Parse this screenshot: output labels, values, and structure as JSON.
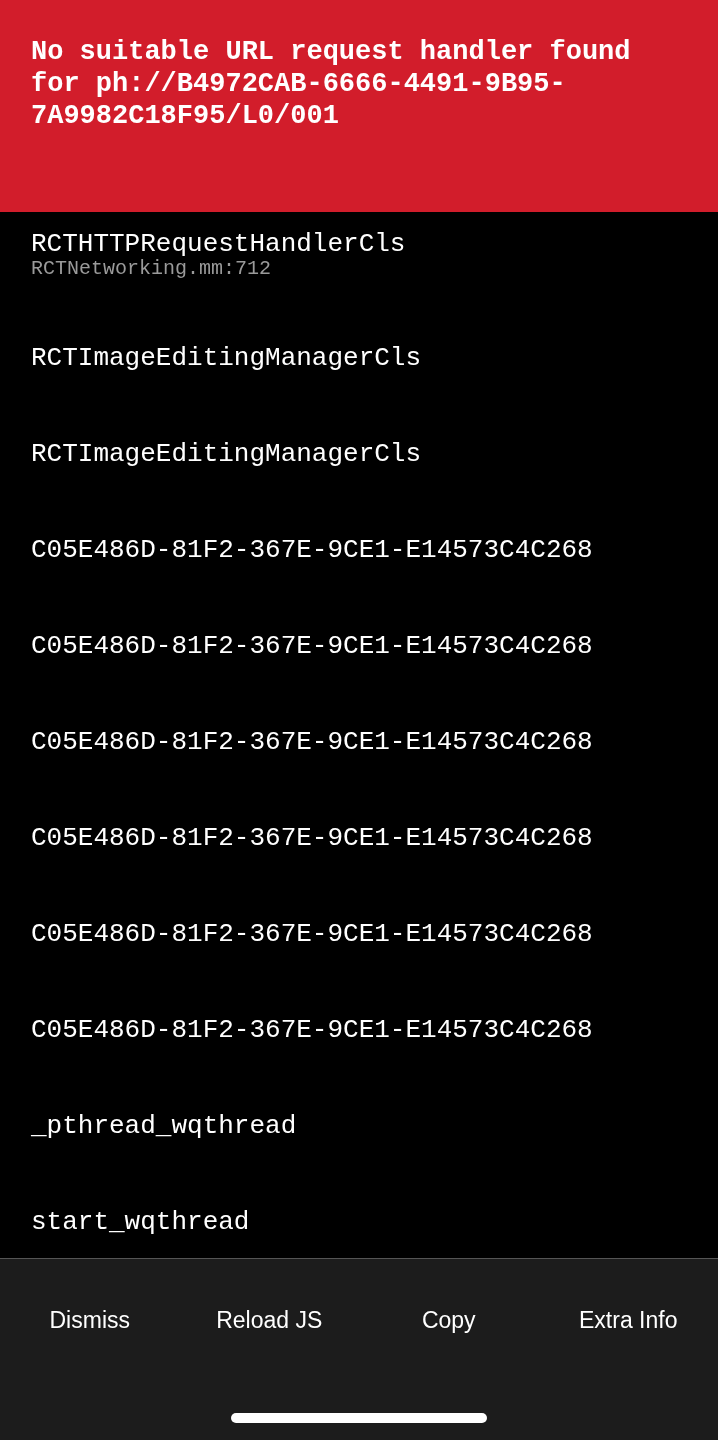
{
  "error": {
    "message": "No suitable URL request handler found for ph://B4972CAB-6666-4491-9B95-7A9982C18F95/L0/001"
  },
  "stack": [
    {
      "method": "RCTHTTPRequestHandlerCls",
      "location": "RCTNetworking.mm:712"
    },
    {
      "method": "RCTImageEditingManagerCls"
    },
    {
      "method": "RCTImageEditingManagerCls"
    },
    {
      "method": "C05E486D-81F2-367E-9CE1-E14573C4C268"
    },
    {
      "method": "C05E486D-81F2-367E-9CE1-E14573C4C268"
    },
    {
      "method": "C05E486D-81F2-367E-9CE1-E14573C4C268"
    },
    {
      "method": "C05E486D-81F2-367E-9CE1-E14573C4C268"
    },
    {
      "method": "C05E486D-81F2-367E-9CE1-E14573C4C268"
    },
    {
      "method": "C05E486D-81F2-367E-9CE1-E14573C4C268"
    },
    {
      "method": "_pthread_wqthread"
    },
    {
      "method": "start_wqthread"
    }
  ],
  "buttons": [
    "Dismiss",
    "Reload JS",
    "Copy",
    "Extra Info"
  ]
}
